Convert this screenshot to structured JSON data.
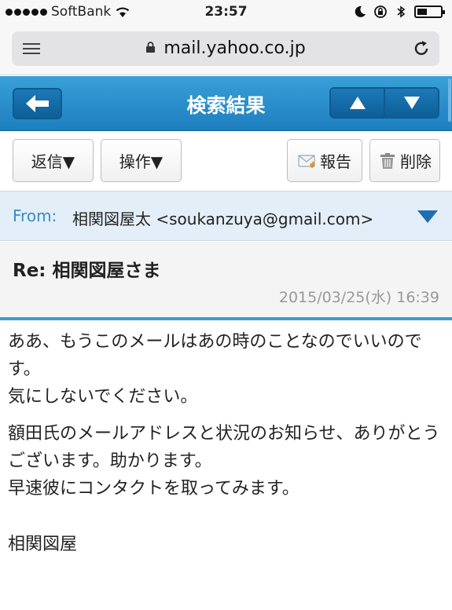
{
  "status_bar": {
    "carrier": "SoftBank",
    "time": "23:57"
  },
  "browser": {
    "url": "mail.yahoo.co.jp"
  },
  "header": {
    "title": "検索結果",
    "accent_color": "#2a8fcf"
  },
  "toolbar": {
    "reply_label": "返信▼",
    "operation_label": "操作▼",
    "report_label": "報告",
    "delete_label": "削除"
  },
  "message": {
    "from_label": "From:",
    "from_value": "相関図屋太 <soukanzuya@gmail.com>",
    "subject": "Re: 相関図屋さま",
    "date": "2015/03/25(水) 16:39",
    "paragraph_1": "ああ、もうこのメールはあの時のことなのでいいのです。\n気にしないでください。",
    "paragraph_2": "額田氏のメールアドレスと状況のお知らせ、ありがとうございます。助かります。\n早速彼にコンタクトを取ってみます。",
    "signature": "相関図屋"
  }
}
